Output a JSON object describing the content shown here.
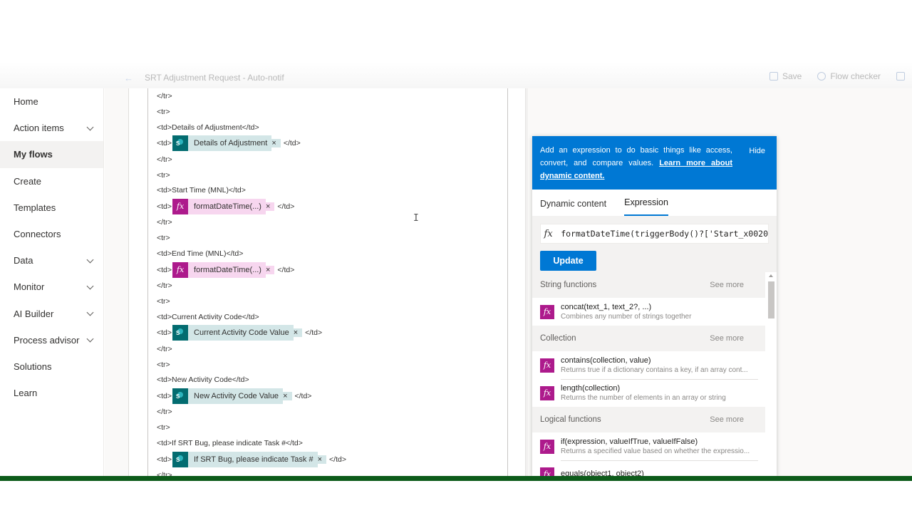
{
  "header": {
    "flow_name": "SRT Adjustment Request - Auto-notif",
    "save_label": "Save",
    "flow_checker_label": "Flow checker"
  },
  "nav": {
    "items": [
      {
        "label": "Home",
        "chevron": false,
        "active": false
      },
      {
        "label": "Action items",
        "chevron": true,
        "active": false
      },
      {
        "label": "My flows",
        "chevron": false,
        "active": true
      },
      {
        "label": "Create",
        "chevron": false,
        "active": false
      },
      {
        "label": "Templates",
        "chevron": false,
        "active": false
      },
      {
        "label": "Connectors",
        "chevron": false,
        "active": false
      },
      {
        "label": "Data",
        "chevron": true,
        "active": false
      },
      {
        "label": "Monitor",
        "chevron": true,
        "active": false
      },
      {
        "label": "AI Builder",
        "chevron": true,
        "active": false
      },
      {
        "label": "Process advisor",
        "chevron": true,
        "active": false
      },
      {
        "label": "Solutions",
        "chevron": false,
        "active": false
      },
      {
        "label": "Learn",
        "chevron": false,
        "active": false
      }
    ]
  },
  "editor": {
    "lines": [
      {
        "pre": "</tr>"
      },
      {
        "pre": "<tr>"
      },
      {
        "pre": "<td>Details of Adjustment</td>"
      },
      {
        "pre": "<td>",
        "token": {
          "kind": "sp",
          "label": "Details of Adjustment"
        },
        "post": "</td>"
      },
      {
        "pre": "</tr>"
      },
      {
        "pre": "<tr>"
      },
      {
        "pre": "<td>Start Time (MNL)</td>"
      },
      {
        "pre": "<td>",
        "token": {
          "kind": "fx",
          "label": "formatDateTime(...)"
        },
        "post": "</td>"
      },
      {
        "pre": "</tr>"
      },
      {
        "pre": "<tr>"
      },
      {
        "pre": "<td>End Time (MNL)</td>"
      },
      {
        "pre": "<td>",
        "token": {
          "kind": "fx",
          "label": "formatDateTime(...)"
        },
        "post": "</td>"
      },
      {
        "pre": "</tr>"
      },
      {
        "pre": "<tr>"
      },
      {
        "pre": "<td>Current Activity Code</td>"
      },
      {
        "pre": "<td>",
        "token": {
          "kind": "sp",
          "label": "Current Activity Code Value"
        },
        "post": "</td>"
      },
      {
        "pre": "</tr>"
      },
      {
        "pre": "<tr>"
      },
      {
        "pre": "<td>New Activity Code</td>"
      },
      {
        "pre": "<td>",
        "token": {
          "kind": "sp",
          "label": "New Activity Code Value"
        },
        "post": "</td>"
      },
      {
        "pre": "</tr>"
      },
      {
        "pre": "<tr>"
      },
      {
        "pre": "<td>If SRT Bug, please indicate Task #</td>"
      },
      {
        "pre": "<td>",
        "token": {
          "kind": "sp",
          "label": "If SRT Bug, please indicate Task #"
        },
        "post": "</td>"
      },
      {
        "pre": "</tr>"
      }
    ]
  },
  "panel": {
    "banner_text": "Add an expression to do basic things like access, convert, and compare values.",
    "banner_link": "Learn more about dynamic content.",
    "hide_label": "Hide",
    "tabs": [
      {
        "label": "Dynamic content",
        "active": false
      },
      {
        "label": "Expression",
        "active": true
      }
    ],
    "expression_value": "formatDateTime(triggerBody()?['Start_x0020",
    "update_label": "Update",
    "groups": [
      {
        "title": "String functions",
        "see_more": "See more",
        "functions": [
          {
            "name": "concat(text_1, text_2?, ...)",
            "desc": "Combines any number of strings together"
          }
        ]
      },
      {
        "title": "Collection",
        "see_more": "See more",
        "functions": [
          {
            "name": "contains(collection, value)",
            "desc": "Returns true if a dictionary contains a key, if an array cont..."
          },
          {
            "name": "length(collection)",
            "desc": "Returns the number of elements in an array or string"
          }
        ]
      },
      {
        "title": "Logical functions",
        "see_more": "See more",
        "functions": [
          {
            "name": "if(expression, valueIfTrue, valueIfFalse)",
            "desc": "Returns a specified value based on whether the expressio..."
          },
          {
            "name": "equals(object1, object2)",
            "desc": ""
          }
        ]
      }
    ]
  },
  "colors": {
    "accent": "#0078d4",
    "function_icon": "#ad1a8c",
    "sharepoint_icon": "#036c70",
    "bottom_bar": "#0d5b1a"
  }
}
